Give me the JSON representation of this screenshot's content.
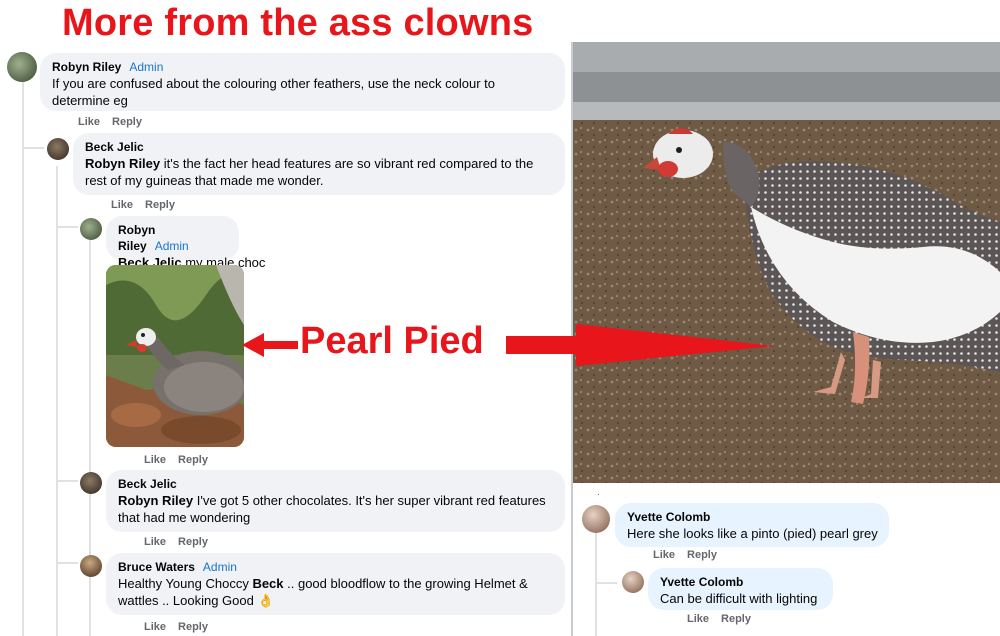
{
  "headline": "More from the ass clowns",
  "annotation": "Pearl Pied",
  "emoji_hand": "👌",
  "comments": [
    {
      "author": "Robyn Riley",
      "badge": "Admin",
      "text": "If you are confused about the colouring other feathers, use the neck colour to determine eg",
      "like": "Like",
      "reply": "Reply"
    },
    {
      "author": "Beck Jelic",
      "mention": "Robyn Riley",
      "text": " it's the fact her head features are so vibrant red compared to the rest of my guineas that made me wonder.",
      "like": "Like",
      "reply": "Reply"
    },
    {
      "author": "Robyn Riley",
      "badge": "Admin",
      "mention": "Beck Jelic",
      "text": " my male choc",
      "like": "Like",
      "reply": "Reply"
    },
    {
      "author": "Beck Jelic",
      "mention": "Robyn Riley",
      "text": " I've got 5 other chocolates. It's her super vibrant red features that had me wondering",
      "like": "Like",
      "reply": "Reply"
    },
    {
      "author": "Bruce Waters",
      "badge": "Admin",
      "text_a": "Healthy Young Choccy ",
      "bold": "Beck",
      "text_b": " .. good bloodflow to the growing Helmet & wattles .. Looking Good ",
      "like": "Like",
      "reply": "Reply"
    }
  ],
  "right_comments": [
    {
      "author": "Yvette Colomb",
      "text": "Here she looks like a pinto (pied) pearl grey",
      "like": "Like",
      "reply": "Reply"
    },
    {
      "author": "Yvette Colomb",
      "text": "Can be difficult with lighting",
      "like": "Like",
      "reply": "Reply"
    }
  ],
  "colors": {
    "headline": "#e8151b",
    "admin_badge": "#1876c9",
    "bubble_bg": "#f0f2f5",
    "right_bubble_bg": "#e7f3ff"
  }
}
